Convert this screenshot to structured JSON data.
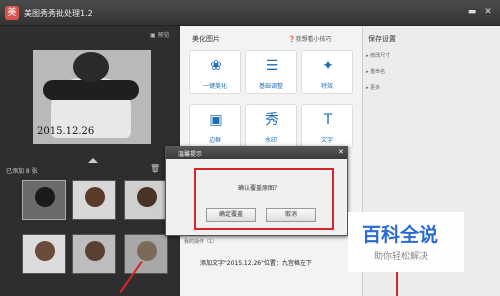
{
  "window": {
    "title": "美图秀秀批处理1.2",
    "min": "▬",
    "close": "✕"
  },
  "left": {
    "preview_btn": "预览",
    "photo_date": "2015.12.26",
    "added_label": "已添加 8 张",
    "thumbs": [
      {
        "color": "#6a6a6a",
        "face": "#1a1a1a"
      },
      {
        "color": "#d8d8d8",
        "face": "#5a3b2a"
      },
      {
        "color": "#cfcfcf",
        "face": "#4a3326"
      },
      {
        "color": "#dcdcdc",
        "face": "#6b4c3a"
      },
      {
        "color": "#bdbdbd",
        "face": "#5a4030"
      },
      {
        "color": "#a8a8a8",
        "face": "#7a6a5a"
      },
      {
        "color": "#909090",
        "face": "#6a5a4a"
      },
      {
        "color": "#c8a040",
        "face": "#3a2a20"
      }
    ]
  },
  "beautify": {
    "title": "美化图片",
    "tips": "我想看小技巧",
    "tiles": [
      {
        "label": "一键美化",
        "icon": "❀"
      },
      {
        "label": "基础调整",
        "icon": "☰"
      },
      {
        "label": "特效",
        "icon": "✦"
      },
      {
        "label": "边框",
        "icon": "▣"
      },
      {
        "label": "水印",
        "icon": "秀"
      },
      {
        "label": "文字",
        "icon": "T"
      }
    ]
  },
  "save": {
    "title": "保存设置",
    "items": [
      "修改尺寸",
      "重命名",
      "更多"
    ]
  },
  "info": {
    "strip": "我的操作（1）",
    "line": "添加文字\"2015.12.26\"位置：九宫格左下"
  },
  "dialog": {
    "title": "温馨提示",
    "close": "✕",
    "message": "确认覆盖原图？",
    "confirm_label": "确定覆盖",
    "cancel_label": "取消"
  },
  "watermark": {
    "line1": "百科全说",
    "line2": "助你轻松解决"
  },
  "colors": {
    "accent": "#1e6fb8",
    "highlight": "#d4262b"
  }
}
